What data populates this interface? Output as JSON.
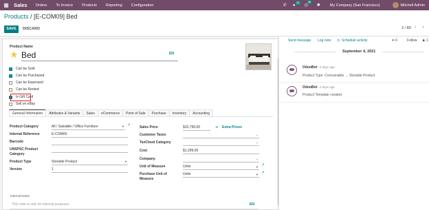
{
  "navbar": {
    "app_name": "Sales",
    "menu": [
      "Orders",
      "To Invoice",
      "Products",
      "Reporting",
      "Configuration"
    ],
    "chat_badge": "22",
    "activity_badge": "36",
    "company": "My Company (San Francisco)",
    "user": "Mitchell Admin"
  },
  "breadcrumb": {
    "parent": "Products",
    "separator": " / ",
    "current": "[E-COM09] Bed"
  },
  "actions": {
    "save": "SAVE",
    "discard": "DISCARD"
  },
  "pager": {
    "text": "2 / 80"
  },
  "product": {
    "name_label": "Product Name",
    "name": "Bed",
    "lang": "EN",
    "checkboxes": [
      {
        "label": "Can be Sold",
        "checked": true
      },
      {
        "label": "Can be Purchased",
        "checked": true
      },
      {
        "label": "Can be Expensed",
        "checked": false
      },
      {
        "label": "Can be Rented",
        "checked": false
      },
      {
        "label": "Is Gift Card",
        "checked": true
      },
      {
        "label": "Sell on eBay",
        "checked": false
      }
    ]
  },
  "tabs": [
    "General Information",
    "Attributes & Variants",
    "Sales",
    "eCommerce",
    "Point of Sale",
    "Purchase",
    "Inventory",
    "Accounting"
  ],
  "left_fields": {
    "category_label": "Product Category",
    "category": "All / Saleable / Office Furniture",
    "internal_ref_label": "Internal Reference",
    "internal_ref": "E-COM09",
    "barcode_label": "Barcode",
    "barcode": "",
    "unspsc_label_1": "UNSPSC Product",
    "unspsc_label_2": "Category",
    "unspsc": "",
    "type_label": "Product Type",
    "type": "Storable Product",
    "version_label": "Version",
    "version": "1"
  },
  "right_fields": {
    "sales_price_label": "Sales Price",
    "sales_price": "$10,799.00",
    "extra_prices": "Extra Prices",
    "customer_taxes_label": "Customer Taxes",
    "taxcloud_label": "TaxCloud Category",
    "cost_label": "Cost",
    "cost": "$1,299.00",
    "company_label": "Company",
    "uom_label": "Unit of Measure",
    "uom": "Units",
    "purchase_uom_label_1": "Purchase Unit of",
    "purchase_uom_label_2": "Measure",
    "purchase_uom": "Units"
  },
  "notes": {
    "label": "Internal Notes",
    "placeholder": "This note is only for internal purposes.",
    "lang": "EN"
  },
  "chatter": {
    "send_message": "Send message",
    "log_note": "Log note",
    "schedule_activity": "Schedule activity",
    "attachments": "0",
    "follow": "Follow",
    "followers": "1",
    "date": "September 4, 2021",
    "messages": [
      {
        "author": "OdooBot",
        "time": "- 2 days ago",
        "body": "Product Type: Consumable → Storable Product"
      },
      {
        "author": "OdooBot",
        "time": "- 2 days ago",
        "body": "Product Template created"
      }
    ]
  }
}
